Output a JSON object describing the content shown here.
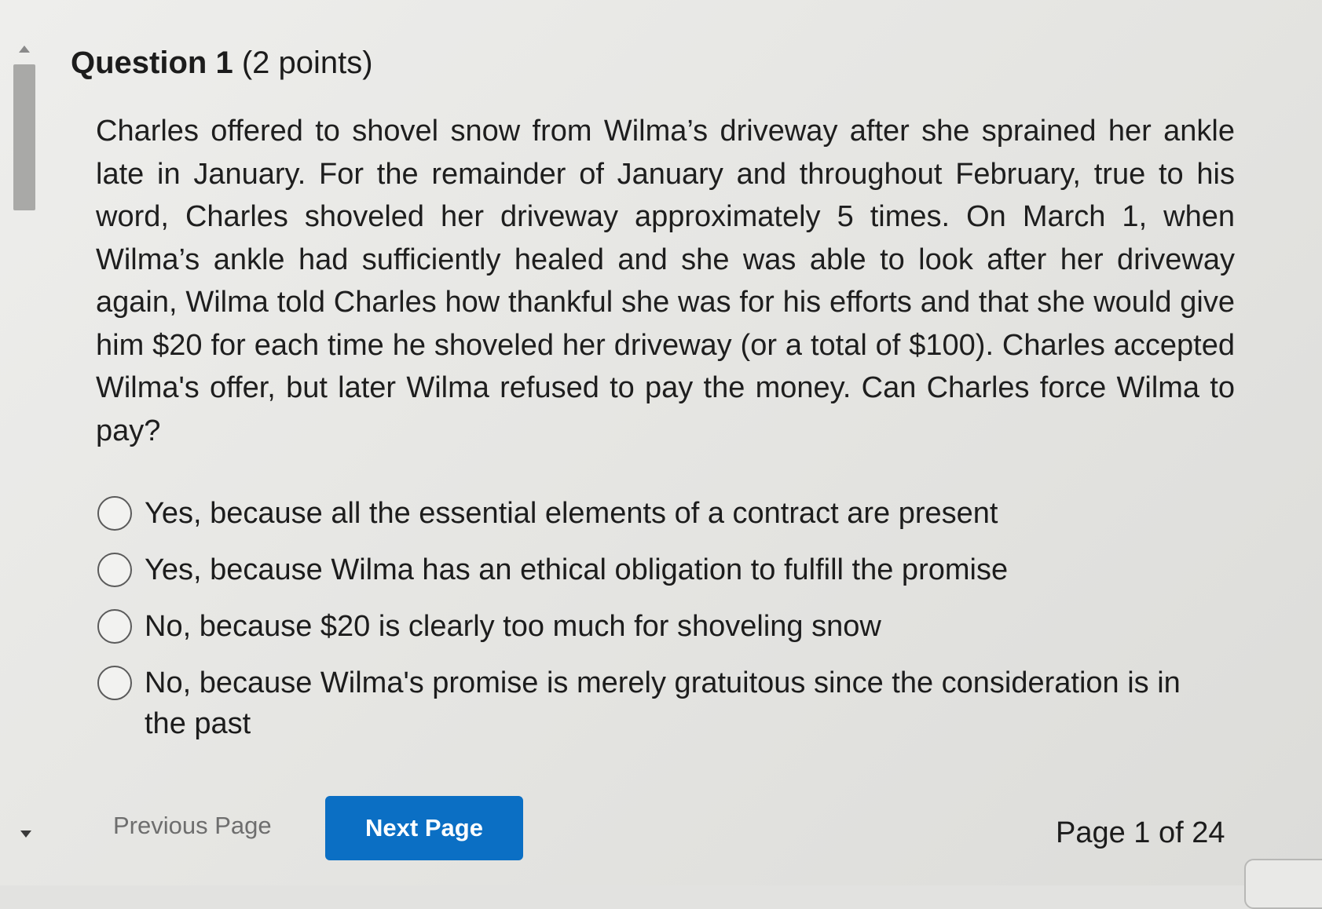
{
  "question": {
    "title": "Question 1",
    "points": "(2 points)",
    "text": "Charles offered to shovel snow from Wilma’s driveway after she sprained her ankle late in January. For the remainder of January and throughout February, true to his word, Charles shoveled her driveway approximately 5 times. On March 1, when Wilma’s ankle had sufficiently healed and she was able to look after her driveway again, Wilma told Charles how thankful she was for his efforts and that she would give him $20 for each time he shoveled her driveway (or a total of $100). Charles accepted Wilma's offer, but later Wilma refused to pay the money. Can Charles force Wilma to pay?"
  },
  "options": [
    {
      "label": "Yes, because all the essential elements of a contract are present",
      "selected": false
    },
    {
      "label": "Yes, because Wilma has an ethical obligation to fulfill the promise",
      "selected": false
    },
    {
      "label": "No, because $20 is clearly too much for shoveling snow",
      "selected": false
    },
    {
      "label": "No, because Wilma's promise is merely gratuitous since the consideration is in the past",
      "selected": false
    }
  ],
  "navigation": {
    "previous_label": "Previous Page",
    "next_label": "Next Page",
    "page_indicator": "Page 1 of 24"
  },
  "colors": {
    "next_button": "#0b6fc4",
    "background": "#e6e6e3"
  }
}
